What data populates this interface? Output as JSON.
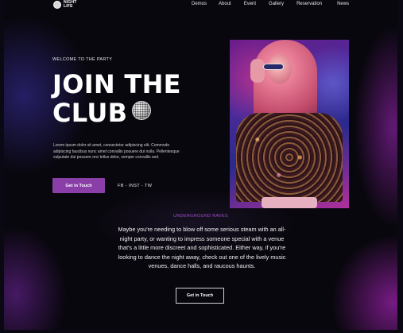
{
  "header": {
    "logo_line1": "NIGHT",
    "logo_line2": "LIFE",
    "nav": [
      "Demos",
      "About",
      "Event",
      "Gallery",
      "Reservation",
      "News"
    ]
  },
  "hero": {
    "eyebrow": "WELCOME TO THE PARTY",
    "title_line1": "JOIN THE",
    "title_line2": "CLUB",
    "description": "Lorem ipsum dolor sit amet, consectetur adipiscing elit. Commodo adipiscing faucibus nunc amet convallis posuere dui nulla. Pellentesque vulputate dui posuere orci tellus dolor, semper convallis sed.",
    "cta_label": "Get in Touch",
    "socials": [
      "FB",
      "INST",
      "TW"
    ],
    "social_separator": " - "
  },
  "about": {
    "kicker": "UNDERGROUND RAVES",
    "body": "Maybe you're needing to blow off some serious steam with an all-night party, or wanting to impress someone special with a venue that's a little more discreet and sophisticated. Either way, if you're looking to dance the night away, check out one of the lively music venues, dance halls, and raucous haunts.",
    "cta_label": "Get in Touch"
  },
  "colors": {
    "accent": "#8a3fa8",
    "kicker": "#a24fc8",
    "background": "#09070e"
  },
  "icons": {
    "logo": "disco-ball-logo-icon",
    "title_decoration": "disco-ball-icon"
  }
}
